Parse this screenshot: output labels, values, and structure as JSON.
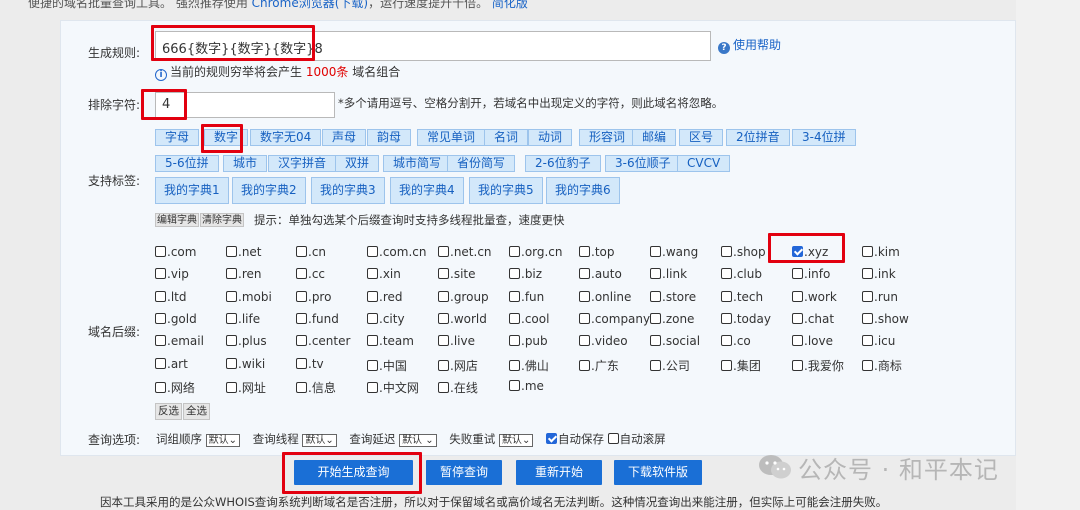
{
  "top_note": {
    "text": "便捷的域名批量查询工具。 强烈推荐使用 ",
    "link1": "Chrome浏览器(下载)",
    "mid": "，运行速度提升十倍。 ",
    "link2": "简化版"
  },
  "rule": {
    "label": "生成规则:",
    "value": "666{数字}{数字}{数字}8",
    "help": "使用帮助",
    "info_prefix": "当前的规则穷举将会产生",
    "info_count": "1000条",
    "info_suffix": "域名组合"
  },
  "exclude": {
    "label": "排除字符:",
    "value": "4",
    "note": "*多个请用逗号、空格分割开，若域名中出现定义的字符，则此域名将忽略。"
  },
  "tags": {
    "label": "支持标签:",
    "row1": [
      "字母",
      "数字",
      "数字无04",
      "声母",
      "韵母",
      "常见单词",
      "名词",
      "动词",
      "形容词",
      "邮编",
      "区号",
      "2位拼音",
      "3-4位拼"
    ],
    "row2": [
      "5-6位拼",
      "城市",
      "汉字拼音",
      "双拼",
      "城市简写",
      "省份简写",
      "2-6位豹子",
      "3-6位顺子",
      "CVCV"
    ],
    "dicts": [
      "我的字典1",
      "我的字典2",
      "我的字典3",
      "我的字典4",
      "我的字典5",
      "我的字典6"
    ],
    "edit": "编辑字典",
    "clear": "清除字典",
    "hint": "提示：单独勾选某个后缀查询时支持多线程批量查，速度更快"
  },
  "suffix": {
    "label": "域名后缀:",
    "rows": [
      [
        ".com",
        ".net",
        ".cn",
        ".com.cn",
        ".net.cn",
        ".org.cn",
        ".top",
        ".wang",
        ".shop",
        ".xyz",
        ".kim"
      ],
      [
        ".vip",
        ".ren",
        ".cc",
        ".xin",
        ".site",
        ".biz",
        ".auto",
        ".link",
        ".club",
        ".info",
        ".ink"
      ],
      [
        ".ltd",
        ".mobi",
        ".pro",
        ".red",
        ".group",
        ".fun",
        ".online",
        ".store",
        ".tech",
        ".work",
        ".run"
      ],
      [
        ".gold",
        ".life",
        ".fund",
        ".city",
        ".world",
        ".cool",
        ".company",
        ".zone",
        ".today",
        ".chat",
        ".show"
      ],
      [
        ".email",
        ".plus",
        ".center",
        ".team",
        ".live",
        ".pub",
        ".video",
        ".social",
        ".co",
        ".love",
        ".icu"
      ],
      [
        ".art",
        ".wiki",
        ".tv",
        ".中国",
        ".网店",
        ".佛山",
        ".广东",
        ".公司",
        ".集团",
        ".我爱你",
        ".商标"
      ],
      [
        ".网络",
        ".网址",
        ".信息",
        ".中文网",
        ".在线",
        ".me"
      ]
    ],
    "checked": ".xyz",
    "invert": "反选",
    "all": "全选"
  },
  "options": {
    "label": "查询选项:",
    "order": "词组顺序",
    "order_val": "默认",
    "threads": "查询线程",
    "threads_val": "默认",
    "delay": "查询延迟",
    "delay_val": "默认",
    "retry": "失败重试",
    "retry_val": "默认",
    "autosave": "自动保存",
    "autoscroll": "自动滚屏"
  },
  "actions": {
    "start": "开始生成查询",
    "pause": "暂停查询",
    "restart": "重新开始",
    "download": "下载软件版"
  },
  "footer": "因本工具采用的是公众WHOIS查询系统判断域名是否注册，所以对于保留域名或高价域名无法判断。这种情况查询出来能注册，但实际上可能会注册失败。",
  "watermark": "公众号 · 和平本记",
  "colors": {
    "accent": "#1a6fd6",
    "highlight": "#e2000f",
    "tag_bg": "#d3e8fa"
  }
}
